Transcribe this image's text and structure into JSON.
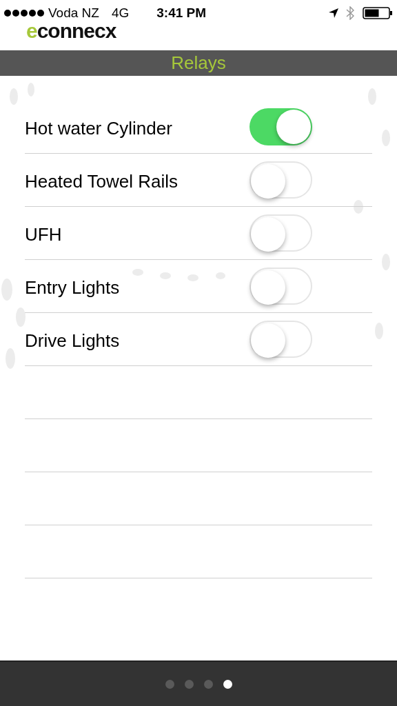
{
  "status_bar": {
    "carrier": "Voda NZ",
    "network": "4G",
    "time": "3:41 PM"
  },
  "logo": "econnecx",
  "title": "Relays",
  "relays": [
    {
      "name": "Hot water Cylinder",
      "on": true
    },
    {
      "name": "Heated Towel Rails",
      "on": false
    },
    {
      "name": "UFH",
      "on": false
    },
    {
      "name": "Entry Lights",
      "on": false
    },
    {
      "name": "Drive Lights",
      "on": false
    }
  ],
  "pages": [
    {
      "selected": false
    },
    {
      "selected": false
    },
    {
      "selected": false
    },
    {
      "selected": true
    }
  ]
}
